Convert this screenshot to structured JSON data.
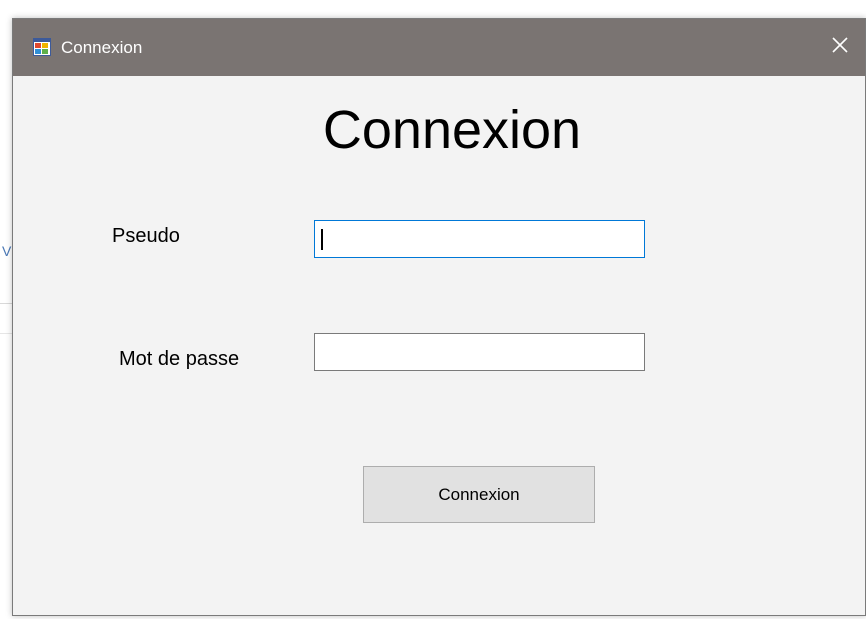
{
  "window": {
    "title": "Connexion",
    "icon": "winforms-app-icon",
    "close_icon": "close-icon"
  },
  "form": {
    "heading": "Connexion",
    "pseudo_label": "Pseudo",
    "pseudo_value": "",
    "password_label": "Mot de passe",
    "password_value": "",
    "submit_label": "Connexion"
  },
  "background_app": {
    "partial_text": "V"
  },
  "colors": {
    "titlebar": "#7a7472",
    "focus_border": "#0078d7",
    "button_bg": "#e1e1e1",
    "client_bg": "#f3f3f3"
  }
}
